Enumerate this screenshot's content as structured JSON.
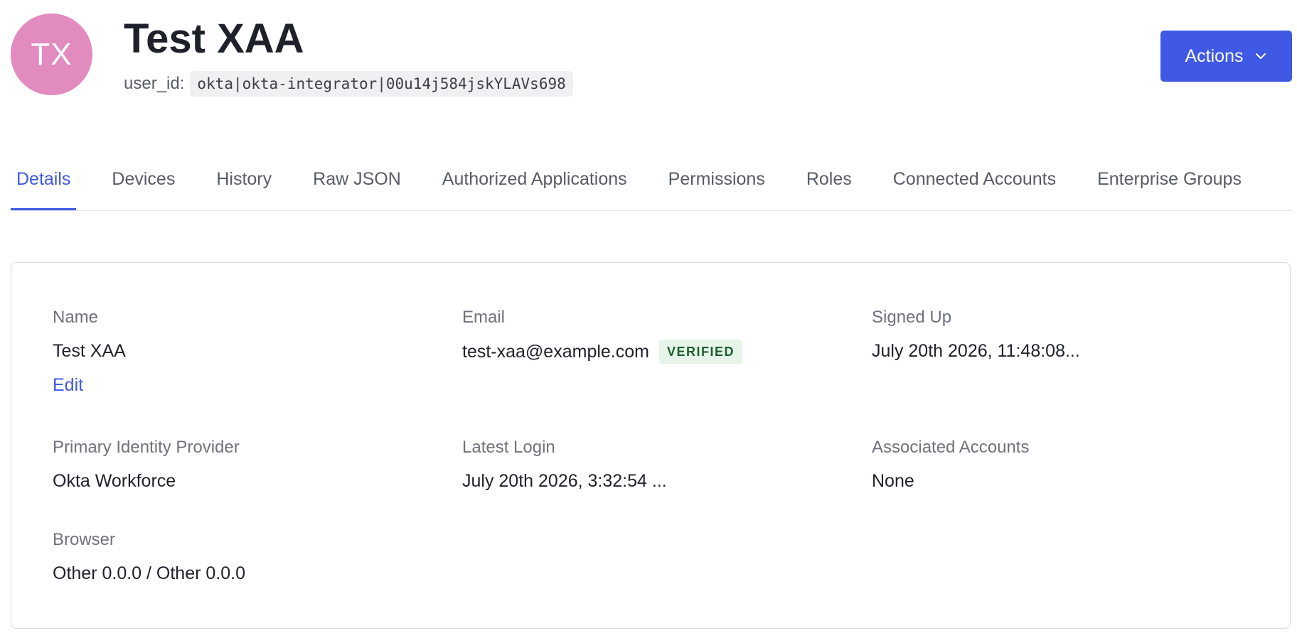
{
  "colors": {
    "accent": "#3f59e4",
    "avatar_bg": "#e18bbf",
    "verified_bg": "#e6f4ea",
    "verified_text": "#1c5e2e"
  },
  "header": {
    "avatar_initials": "TX",
    "title": "Test XAA",
    "user_id_label": "user_id:",
    "user_id_value": "okta|okta-integrator|00u14j584jskYLAVs698",
    "actions_label": "Actions",
    "actions_icon": "chevron-down-icon"
  },
  "tabs": [
    {
      "label": "Details",
      "active": true
    },
    {
      "label": "Devices",
      "active": false
    },
    {
      "label": "History",
      "active": false
    },
    {
      "label": "Raw JSON",
      "active": false
    },
    {
      "label": "Authorized Applications",
      "active": false
    },
    {
      "label": "Permissions",
      "active": false
    },
    {
      "label": "Roles",
      "active": false
    },
    {
      "label": "Connected Accounts",
      "active": false
    },
    {
      "label": "Enterprise Groups",
      "active": false
    }
  ],
  "details": {
    "name": {
      "label": "Name",
      "value": "Test XAA",
      "edit_label": "Edit"
    },
    "email": {
      "label": "Email",
      "value": "test-xaa@example.com",
      "badge": "VERIFIED"
    },
    "signed_up": {
      "label": "Signed Up",
      "value": "July 20th 2026, 11:48:08..."
    },
    "primary_idp": {
      "label": "Primary Identity Provider",
      "value": "Okta Workforce"
    },
    "latest_login": {
      "label": "Latest Login",
      "value": "July 20th 2026, 3:32:54 ..."
    },
    "associated_accounts": {
      "label": "Associated Accounts",
      "value": "None"
    },
    "browser": {
      "label": "Browser",
      "value": "Other 0.0.0 / Other 0.0.0"
    }
  }
}
